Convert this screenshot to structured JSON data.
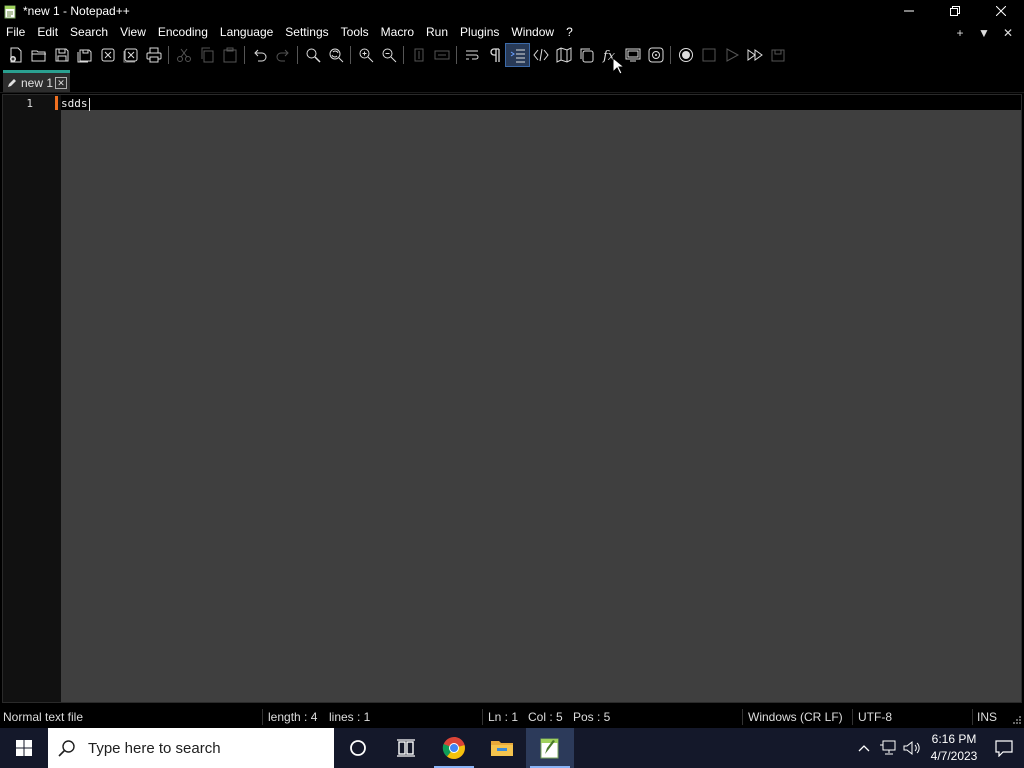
{
  "window": {
    "title": "*new 1 - Notepad++",
    "controls": {
      "minimize": "—",
      "restore": "❐",
      "close": "✕"
    }
  },
  "menu": {
    "items": [
      "File",
      "Edit",
      "Search",
      "View",
      "Encoding",
      "Language",
      "Settings",
      "Tools",
      "Macro",
      "Run",
      "Plugins",
      "Window",
      "?"
    ],
    "right": {
      "add": "+",
      "dropdown": "▼",
      "close": "✕"
    }
  },
  "toolbar": {
    "icons": [
      "new-file-icon",
      "open-file-icon",
      "save-icon",
      "save-all-icon",
      "close-icon",
      "close-all-icon",
      "print-icon",
      "cut-icon",
      "copy-icon",
      "paste-icon",
      "undo-icon",
      "redo-icon",
      "find-icon",
      "replace-icon",
      "zoom-in-icon",
      "zoom-out-icon",
      "sync-vertical-icon",
      "sync-horizontal-icon",
      "word-wrap-icon",
      "show-all-characters-icon",
      "indent-guide-icon",
      "user-defined-language-icon",
      "document-map-icon",
      "document-list-icon",
      "function-list-icon",
      "folder-as-workspace-icon",
      "monitoring-icon",
      "record-macro-icon",
      "stop-recording-icon",
      "play-macro-icon",
      "run-macro-multiple-icon",
      "save-macro-icon"
    ],
    "selected": "indent-guide-icon"
  },
  "tabs": [
    {
      "label": "new 1",
      "close": "✕"
    }
  ],
  "editor": {
    "lines": [
      {
        "number": "1",
        "text": "sdds"
      }
    ]
  },
  "status": {
    "file_type": "Normal text file",
    "length": "length : 4",
    "lines": "lines : 1",
    "ln": "Ln : 1",
    "col": "Col : 5",
    "pos": "Pos : 5",
    "eol": "Windows (CR LF)",
    "encoding": "UTF-8",
    "mode": "INS"
  },
  "taskbar": {
    "search_placeholder": "Type here to search",
    "apps": [
      "cortana-icon",
      "task-view-icon",
      "chrome-icon",
      "file-explorer-icon",
      "notepadpp-icon"
    ],
    "active_app": "notepadpp-icon",
    "clock": {
      "time": "6:16 PM",
      "date": "4/7/2023"
    }
  },
  "colors": {
    "accent_tab": "#2aa090",
    "change_marker": "#f07020",
    "editor_bg": "#3f3f3f",
    "taskbar_bg": "#14182a"
  }
}
